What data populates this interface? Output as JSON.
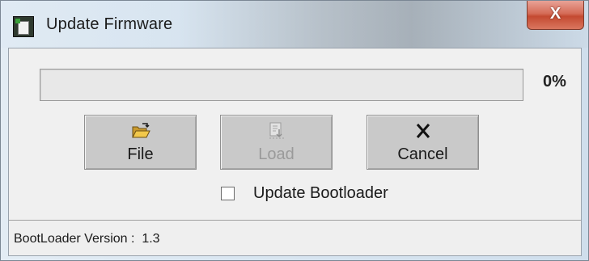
{
  "window": {
    "title": "Update Firmware",
    "close_label": "X"
  },
  "progress": {
    "percent_label": "0%",
    "value": 0,
    "fill_color": "#3cb04a"
  },
  "buttons": {
    "file": {
      "label": "File",
      "icon": "folder-open-icon",
      "enabled": true
    },
    "load": {
      "label": "Load",
      "icon": "load-document-icon",
      "enabled": false
    },
    "cancel": {
      "label": "Cancel",
      "icon": "cancel-x-icon",
      "enabled": true
    }
  },
  "options": {
    "update_bootloader": {
      "label": "Update Bootloader",
      "checked": false
    }
  },
  "status": {
    "text": "BootLoader Version :  1.3"
  },
  "colors": {
    "close_button": "#c44a31",
    "button_face": "#c9c9c9"
  }
}
